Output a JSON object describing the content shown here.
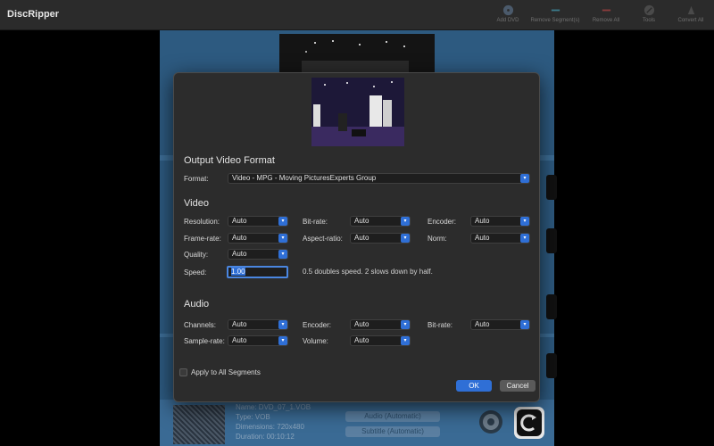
{
  "app": {
    "title": "DiscRipper"
  },
  "toolbar": {
    "add_dvd": "Add DVD",
    "remove_segments": "Remove Segment(s)",
    "remove_all": "Remove All",
    "tools": "Tools",
    "convert_all": "Convert All"
  },
  "bottom_item": {
    "name": "Name: DVD_07_1.VOB",
    "type": "Type: VOB",
    "dimensions": "Dimensions: 720x480",
    "duration": "Duration: 00:10:12",
    "audio": "Audio (Automatic)",
    "subtitle": "Subtitle (Automatic)"
  },
  "dialog": {
    "output_title": "Output Video Format",
    "format_label": "Format:",
    "format_value": "Video - MPG - Moving PicturesExperts Group",
    "video_title": "Video",
    "resolution_label": "Resolution:",
    "resolution_value": "Auto",
    "bitrate_label": "Bit-rate:",
    "bitrate_value": "Auto",
    "encoder_label": "Encoder:",
    "encoder_value": "Auto",
    "framerate_label": "Frame-rate:",
    "framerate_value": "Auto",
    "aspect_label": "Aspect-ratio:",
    "aspect_value": "Auto",
    "norm_label": "Norm:",
    "norm_value": "Auto",
    "quality_label": "Quality:",
    "quality_value": "Auto",
    "speed_label": "Speed:",
    "speed_value": "1.00",
    "speed_hint": "0.5 doubles speed. 2 slows down by half.",
    "audio_title": "Audio",
    "channels_label": "Channels:",
    "channels_value": "Auto",
    "a_encoder_label": "Encoder:",
    "a_encoder_value": "Auto",
    "a_bitrate_label": "Bit-rate:",
    "a_bitrate_value": "Auto",
    "samplerate_label": "Sample-rate:",
    "samplerate_value": "Auto",
    "volume_label": "Volume:",
    "volume_value": "Auto",
    "apply_all": "Apply to All Segments",
    "ok": "OK",
    "cancel": "Cancel"
  },
  "colors": {
    "accent": "#2f6fd6",
    "dialog_bg": "#2c2c2c",
    "list_bg": "#2d5a80"
  }
}
